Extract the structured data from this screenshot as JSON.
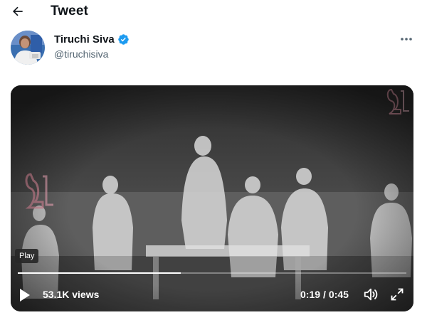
{
  "header": {
    "title": "Tweet",
    "back_icon": "arrow-left-icon"
  },
  "tweet": {
    "author": {
      "name": "Tiruchi Siva",
      "handle": "@tiruchisiva",
      "verified": true,
      "verified_color": "#1d9bf0",
      "avatar_icon": "avatar-photo"
    },
    "more_icon": "more-horizontal-icon",
    "video": {
      "tooltip": "Play",
      "views": "53.1K views",
      "current_time": "0:19",
      "time_separator": "/",
      "duration": "0:45",
      "progress": 0.42,
      "play_icon": "play-icon",
      "volume_icon": "volume-icon",
      "fullscreen_icon": "fullscreen-icon",
      "watermark_icon": "channel-logo-watermark"
    }
  },
  "colors": {
    "text_primary": "#0f1419",
    "text_secondary": "#536471",
    "video_controls": "#ffffff"
  }
}
